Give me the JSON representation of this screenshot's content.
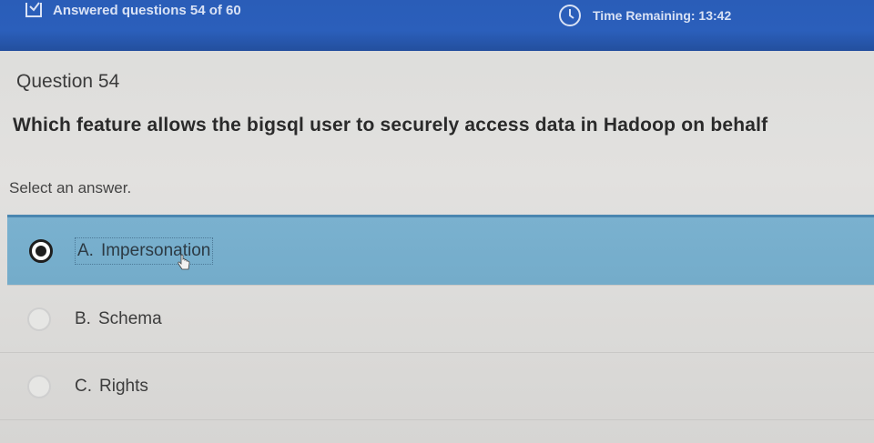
{
  "header": {
    "answered_text": "Answered questions 54 of 60",
    "time_remaining_text": "Time Remaining: 13:42"
  },
  "question": {
    "title": "Question 54",
    "text": "Which feature allows the bigsql user to securely access data in Hadoop on behalf",
    "instruction": "Select an answer."
  },
  "answers": [
    {
      "letter": "A.",
      "text": "Impersonation",
      "selected": true
    },
    {
      "letter": "B.",
      "text": "Schema",
      "selected": false
    },
    {
      "letter": "C.",
      "text": "Rights",
      "selected": false
    }
  ],
  "colors": {
    "header_bg": "#2b5fbb",
    "selected_bg": "#7ab1cf"
  },
  "icons": {
    "answered": "checkbox-icon",
    "timer": "clock-icon",
    "pointer": "hand-cursor-icon"
  }
}
